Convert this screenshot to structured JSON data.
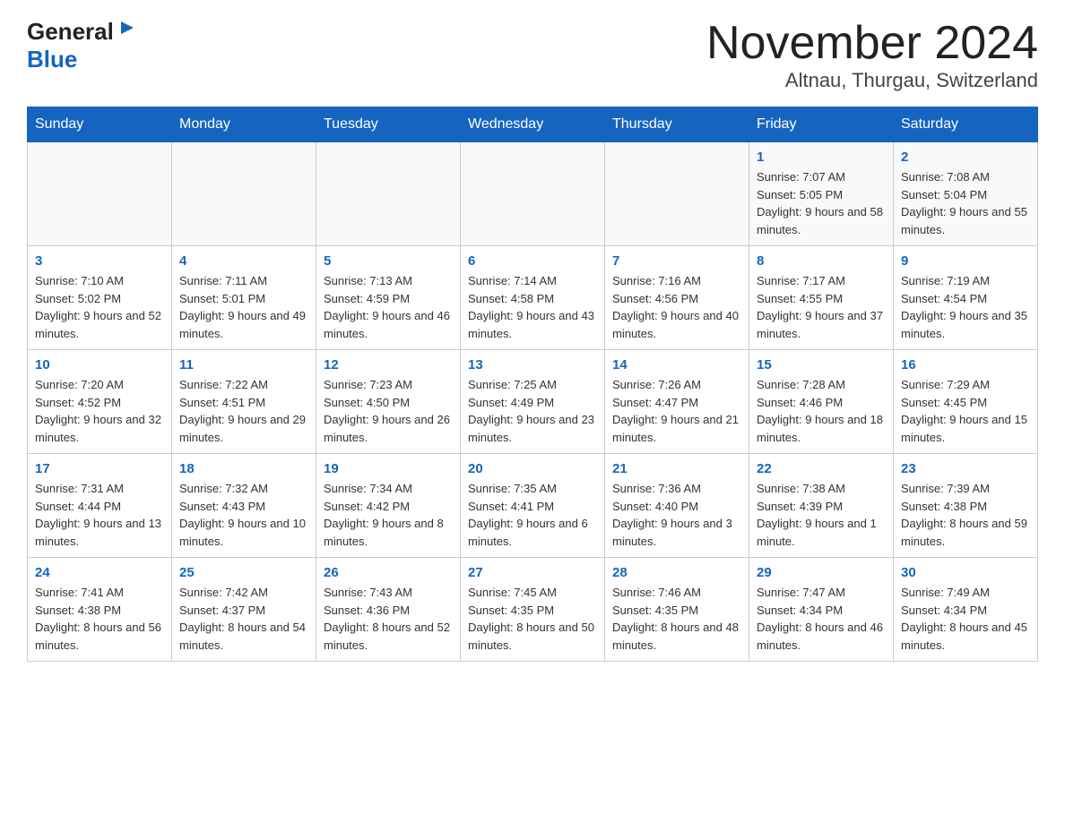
{
  "header": {
    "logo_general": "General",
    "logo_blue": "Blue",
    "title": "November 2024",
    "subtitle": "Altnau, Thurgau, Switzerland"
  },
  "calendar": {
    "days_of_week": [
      "Sunday",
      "Monday",
      "Tuesday",
      "Wednesday",
      "Thursday",
      "Friday",
      "Saturday"
    ],
    "weeks": [
      [
        {
          "day": "",
          "info": ""
        },
        {
          "day": "",
          "info": ""
        },
        {
          "day": "",
          "info": ""
        },
        {
          "day": "",
          "info": ""
        },
        {
          "day": "",
          "info": ""
        },
        {
          "day": "1",
          "info": "Sunrise: 7:07 AM\nSunset: 5:05 PM\nDaylight: 9 hours and 58 minutes."
        },
        {
          "day": "2",
          "info": "Sunrise: 7:08 AM\nSunset: 5:04 PM\nDaylight: 9 hours and 55 minutes."
        }
      ],
      [
        {
          "day": "3",
          "info": "Sunrise: 7:10 AM\nSunset: 5:02 PM\nDaylight: 9 hours and 52 minutes."
        },
        {
          "day": "4",
          "info": "Sunrise: 7:11 AM\nSunset: 5:01 PM\nDaylight: 9 hours and 49 minutes."
        },
        {
          "day": "5",
          "info": "Sunrise: 7:13 AM\nSunset: 4:59 PM\nDaylight: 9 hours and 46 minutes."
        },
        {
          "day": "6",
          "info": "Sunrise: 7:14 AM\nSunset: 4:58 PM\nDaylight: 9 hours and 43 minutes."
        },
        {
          "day": "7",
          "info": "Sunrise: 7:16 AM\nSunset: 4:56 PM\nDaylight: 9 hours and 40 minutes."
        },
        {
          "day": "8",
          "info": "Sunrise: 7:17 AM\nSunset: 4:55 PM\nDaylight: 9 hours and 37 minutes."
        },
        {
          "day": "9",
          "info": "Sunrise: 7:19 AM\nSunset: 4:54 PM\nDaylight: 9 hours and 35 minutes."
        }
      ],
      [
        {
          "day": "10",
          "info": "Sunrise: 7:20 AM\nSunset: 4:52 PM\nDaylight: 9 hours and 32 minutes."
        },
        {
          "day": "11",
          "info": "Sunrise: 7:22 AM\nSunset: 4:51 PM\nDaylight: 9 hours and 29 minutes."
        },
        {
          "day": "12",
          "info": "Sunrise: 7:23 AM\nSunset: 4:50 PM\nDaylight: 9 hours and 26 minutes."
        },
        {
          "day": "13",
          "info": "Sunrise: 7:25 AM\nSunset: 4:49 PM\nDaylight: 9 hours and 23 minutes."
        },
        {
          "day": "14",
          "info": "Sunrise: 7:26 AM\nSunset: 4:47 PM\nDaylight: 9 hours and 21 minutes."
        },
        {
          "day": "15",
          "info": "Sunrise: 7:28 AM\nSunset: 4:46 PM\nDaylight: 9 hours and 18 minutes."
        },
        {
          "day": "16",
          "info": "Sunrise: 7:29 AM\nSunset: 4:45 PM\nDaylight: 9 hours and 15 minutes."
        }
      ],
      [
        {
          "day": "17",
          "info": "Sunrise: 7:31 AM\nSunset: 4:44 PM\nDaylight: 9 hours and 13 minutes."
        },
        {
          "day": "18",
          "info": "Sunrise: 7:32 AM\nSunset: 4:43 PM\nDaylight: 9 hours and 10 minutes."
        },
        {
          "day": "19",
          "info": "Sunrise: 7:34 AM\nSunset: 4:42 PM\nDaylight: 9 hours and 8 minutes."
        },
        {
          "day": "20",
          "info": "Sunrise: 7:35 AM\nSunset: 4:41 PM\nDaylight: 9 hours and 6 minutes."
        },
        {
          "day": "21",
          "info": "Sunrise: 7:36 AM\nSunset: 4:40 PM\nDaylight: 9 hours and 3 minutes."
        },
        {
          "day": "22",
          "info": "Sunrise: 7:38 AM\nSunset: 4:39 PM\nDaylight: 9 hours and 1 minute."
        },
        {
          "day": "23",
          "info": "Sunrise: 7:39 AM\nSunset: 4:38 PM\nDaylight: 8 hours and 59 minutes."
        }
      ],
      [
        {
          "day": "24",
          "info": "Sunrise: 7:41 AM\nSunset: 4:38 PM\nDaylight: 8 hours and 56 minutes."
        },
        {
          "day": "25",
          "info": "Sunrise: 7:42 AM\nSunset: 4:37 PM\nDaylight: 8 hours and 54 minutes."
        },
        {
          "day": "26",
          "info": "Sunrise: 7:43 AM\nSunset: 4:36 PM\nDaylight: 8 hours and 52 minutes."
        },
        {
          "day": "27",
          "info": "Sunrise: 7:45 AM\nSunset: 4:35 PM\nDaylight: 8 hours and 50 minutes."
        },
        {
          "day": "28",
          "info": "Sunrise: 7:46 AM\nSunset: 4:35 PM\nDaylight: 8 hours and 48 minutes."
        },
        {
          "day": "29",
          "info": "Sunrise: 7:47 AM\nSunset: 4:34 PM\nDaylight: 8 hours and 46 minutes."
        },
        {
          "day": "30",
          "info": "Sunrise: 7:49 AM\nSunset: 4:34 PM\nDaylight: 8 hours and 45 minutes."
        }
      ]
    ]
  }
}
